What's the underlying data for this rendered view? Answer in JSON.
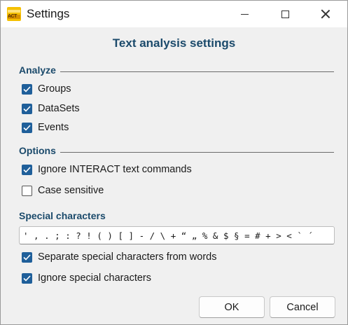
{
  "window": {
    "title": "Settings",
    "app_icon": "interact-app-icon",
    "app_icon_text": "ACT",
    "controls": [
      "minimize-icon",
      "maximize-icon",
      "close-icon"
    ]
  },
  "dialog": {
    "heading": "Text analysis settings"
  },
  "analyze": {
    "label": "Analyze",
    "items": [
      {
        "label": "Groups",
        "checked": true
      },
      {
        "label": "DataSets",
        "checked": true
      },
      {
        "label": "Events",
        "checked": true
      }
    ]
  },
  "options": {
    "label": "Options",
    "items": [
      {
        "label": "Ignore INTERACT text commands",
        "checked": true
      },
      {
        "label": "Case sensitive",
        "checked": false
      }
    ]
  },
  "special": {
    "label": "Special characters",
    "value": "' , . ; : ? ! ( ) [ ] - / \\ + “ „ % & $ § = # + > < ` ´",
    "items": [
      {
        "label": "Separate special characters from words",
        "checked": true
      },
      {
        "label": "Ignore special characters",
        "checked": true
      }
    ]
  },
  "buttons": {
    "ok": "OK",
    "cancel": "Cancel"
  },
  "colors": {
    "accent": "#1f5f9a",
    "heading": "#1b4a6b",
    "background": "#f0f0f0"
  }
}
